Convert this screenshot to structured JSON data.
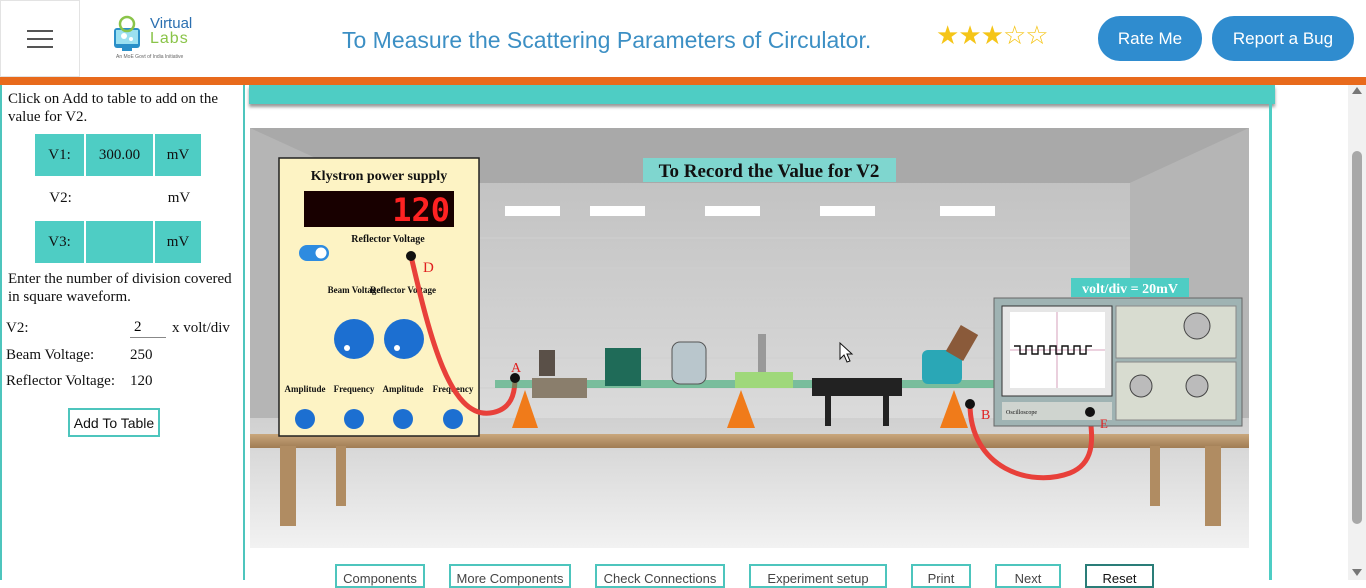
{
  "header": {
    "title": "To Measure the Scattering Parameters of Circulator.",
    "logo_line1": "Virtual",
    "logo_line2": "Labs",
    "logo_tagline": "An MoE Govt of India Initiative",
    "rating": {
      "filled": 3,
      "total": 5
    },
    "rate_label": "Rate Me",
    "bug_label": "Report a Bug"
  },
  "left_panel": {
    "instruction": "Click on Add to table to add on the value for V2.",
    "v1": {
      "label": "V1:",
      "value": "300.00",
      "unit": "mV"
    },
    "v2": {
      "label": "V2:",
      "value": "",
      "unit": "mV"
    },
    "v3": {
      "label": "V3:",
      "value": "",
      "unit": "mV"
    },
    "division_instruction": "Enter the number of division covered in square waveform.",
    "v2_div": {
      "label": "V2:",
      "value": "2",
      "suffix": "x volt/div"
    },
    "beam": {
      "label": "Beam Voltage:",
      "value": "250"
    },
    "reflector": {
      "label": "Reflector Voltage:",
      "value": "120"
    },
    "add_label": "Add To Table"
  },
  "simulation": {
    "banner": "To Record the Value for V2",
    "volt_div": "volt/div = 20mV",
    "power_supply": {
      "title": "Klystron power supply",
      "display": "120",
      "reflector_label": "Reflector Voltage",
      "beam_knob": "Beam Voltage",
      "reflector_knob": "Reflector Voltage",
      "bottom_labels": [
        "Amplitude",
        "Frequency",
        "Amplitude",
        "Frequency"
      ]
    },
    "points": {
      "a": "A",
      "b": "B",
      "d": "D",
      "e": "E"
    },
    "oscilloscope_label": "Oscilloscope"
  },
  "toolbar": {
    "components": "Components",
    "more_components": "More Components",
    "check_connections": "Check Connections",
    "experiment_setup": "Experiment setup",
    "print": "Print",
    "next": "Next",
    "reset": "Reset"
  },
  "colors": {
    "accent": "#4ecdc4",
    "header_blue": "#2f8ccf",
    "orange": "#e86a1c",
    "title_blue": "#3c8fc4"
  }
}
